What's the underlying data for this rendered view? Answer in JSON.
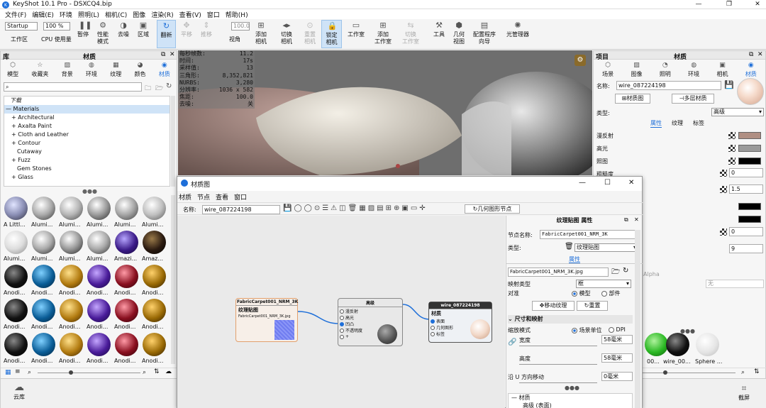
{
  "window": {
    "title": "KeyShot 10.1 Pro - DSXCQ4.bip"
  },
  "menu": [
    "文件(F)",
    "编辑(E)",
    "环境",
    "照明(L)",
    "相机(C)",
    "图像",
    "渲染(R)",
    "查看(V)",
    "窗口",
    "帮助(H)"
  ],
  "toolbar": {
    "workspace_select": "Startup",
    "zoom_select": "100 %",
    "cpu": "CPU 使用量",
    "workspace_label": "工作区",
    "items": [
      {
        "label": "暂停",
        "icon": "pause-icon"
      },
      {
        "label": "性能\n模式",
        "icon": "gear-icon"
      },
      {
        "label": "去噪",
        "icon": "denoise-icon"
      },
      {
        "label": "区域",
        "icon": "region-icon"
      },
      {
        "label": "翻新",
        "icon": "refresh-icon"
      },
      {
        "label": "平移",
        "icon": "move-icon"
      },
      {
        "label": "推移",
        "icon": "dolly-icon"
      },
      {
        "label": "视角",
        "icon": "perspective-icon"
      },
      {
        "label": "添加\n相机",
        "icon": "add-camera-icon"
      },
      {
        "label": "切换\n相机",
        "icon": "switch-camera-icon"
      },
      {
        "label": "重置\n相机",
        "icon": "reset-camera-icon"
      },
      {
        "label": "锁定\n相机",
        "icon": "lock-camera-icon"
      },
      {
        "label": "工作室",
        "icon": "studio-icon"
      },
      {
        "label": "添加\n工作室",
        "icon": "add-studio-icon"
      },
      {
        "label": "切换\n工作室",
        "icon": "switch-studio-icon"
      },
      {
        "label": "工具",
        "icon": "tools-icon"
      },
      {
        "label": "几何\n视图",
        "icon": "geometry-view-icon"
      },
      {
        "label": "配置程序\n向导",
        "icon": "configurator-icon"
      },
      {
        "label": "光管理器",
        "icon": "light-manager-icon"
      }
    ],
    "fov_value": "100.0"
  },
  "library": {
    "title_left": "库",
    "title": "材质",
    "tabs": [
      "模型",
      "收藏夹",
      "背景",
      "环境",
      "纹理",
      "颜色",
      "材质"
    ],
    "search_placeholder": "",
    "tree": [
      "下载",
      "Materials",
      "Architectural",
      "Axalta Paint",
      "Cloth and Leather",
      "Contour",
      "Cutaway",
      "Fuzz",
      "Gem Stones",
      "Glass"
    ],
    "thumbs": [
      [
        "A Littl...",
        "Alumi...",
        "Alumi...",
        "Alumi...",
        "Alumi...",
        "Alumi..."
      ],
      [
        "Alumi...",
        "Alumi...",
        "Alumi...",
        "Alumi...",
        "Amazi...",
        "Amaz..."
      ],
      [
        "Anodi...",
        "Anodi...",
        "Anodi...",
        "Anodi...",
        "Anodi...",
        "Anodi..."
      ],
      [
        "Anodi...",
        "Anodi...",
        "Anodi...",
        "Anodi...",
        "Anodi...",
        "Anodi..."
      ],
      [
        "Anodi...",
        "Anodi...",
        "Anodi...",
        "Anodi...",
        "Anodi...",
        "Anodi..."
      ]
    ],
    "cloud": "云库"
  },
  "stats": [
    [
      "每秒帧数:",
      "11.2"
    ],
    [
      "时间:",
      "17s"
    ],
    [
      "采样值:",
      "13"
    ],
    [
      "三角形:",
      "8,352,821"
    ],
    [
      "NURBS:",
      "3,280"
    ],
    [
      "分辨率:",
      "1036 x 582"
    ],
    [
      "焦距:",
      "100.0"
    ],
    [
      "去噪:",
      "关"
    ]
  ],
  "project": {
    "title_left": "项目",
    "title": "材质",
    "tabs": [
      "场景",
      "图像",
      "照明",
      "环境",
      "相机",
      "材质"
    ],
    "name_label": "名称:",
    "name_value": "wire_087224198",
    "graph_button": "材质图",
    "multi_button": "多层材质",
    "type_label": "类型:",
    "type_value": "高级",
    "subtabs": [
      "属性",
      "纹理",
      "标签"
    ],
    "props": [
      "漫反射",
      "高光",
      "照图",
      "粗糙度"
    ],
    "rough_value": "0",
    "val_1": "1.5",
    "val_2": "0",
    "val_3": "9",
    "alpha_label": "Alpha",
    "none_select": "无",
    "thumb_labels": [
      "00...",
      "wire_00...",
      "Sphere ..."
    ],
    "screenshot": "截屏"
  },
  "matgraph": {
    "title": "材质图",
    "menu": [
      "材质",
      "节点",
      "查看",
      "窗口"
    ],
    "name_label": "名称:",
    "name_value": "wire_087224198",
    "geom_node_button": "几何图形节点",
    "node_texture": {
      "header": "FabricCarpet001_NRM_3K",
      "title": "纹理贴图",
      "file": "FabricCarpet001_NRM_3K.jpg"
    },
    "node_advanced": {
      "header": "高级",
      "ports": [
        "漫反射",
        "高光",
        "凹凸",
        "不透明度",
        "+"
      ]
    },
    "node_material": {
      "header": "wire_087224198",
      "title": "材质",
      "ports": [
        "表面",
        "几何图形",
        "标签"
      ]
    }
  },
  "texprops": {
    "title": "纹理贴图 属性",
    "node_name_label": "节点名称:",
    "node_name_value": "FabricCarpet001_NRM_3K",
    "type_label": "类型:",
    "type_value": "纹理贴图",
    "tab": "属性",
    "file_value": "FabricCarpet001_NRM_3K.jpg",
    "map_type_label": "映射类型",
    "map_type_value": "框",
    "align_label": "对准",
    "align_opt1": "模型",
    "align_opt2": "部件",
    "move_texture": "移动纹理",
    "reset": "重置",
    "section_size": "尺寸和映射",
    "scale_mode_label": "缩放模式",
    "scale_opt1": "场景单位",
    "scale_opt2": "DPI",
    "width_label": "宽度",
    "width_value": "58毫米",
    "height_label": "高度",
    "height_value": "58毫米",
    "move_u_label": "沿 U 方向移动",
    "move_u_value": "0毫米",
    "tree_root": "材质",
    "tree_child": "高级 (表面)"
  },
  "colors": {
    "accent": "#1e6fd9",
    "diffuse": "#b08f83",
    "specular": "#9a9a9a",
    "black": "#000000"
  }
}
